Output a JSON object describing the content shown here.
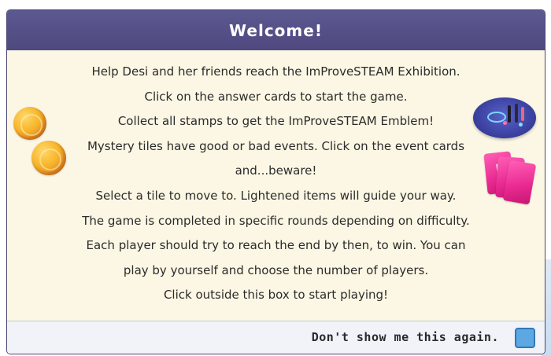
{
  "dialog": {
    "title": "Welcome!",
    "lines": [
      "Help Desi and her friends reach the ImProveSTEAM Exhibition.",
      "Click on the answer cards to start the game.",
      "Collect all stamps to get the ImProveSTEAM Emblem!",
      "Mystery tiles have good or bad events. Click on the event cards",
      "and...beware!",
      "Select a tile to move to. Lightened items will guide your way.",
      "The game is completed in specific rounds depending on difficulty.",
      "Each player should try to reach the end by then, to win. You can",
      "play by yourself and choose the number of players.",
      "Click outside this box to start playing!"
    ],
    "footer": {
      "dont_show_label": "Don't show me this again."
    },
    "card_symbol": "!"
  },
  "icons": {
    "coins": "coin-icon",
    "event_cards": "event-cards-icon",
    "exhibition": "exhibition-icon"
  },
  "colors": {
    "header": "#524e86",
    "body": "#fbf7e4",
    "footer": "#f1f3f9",
    "checkbox": "#5da8e2",
    "event_card": "#e8288f",
    "coin": "#f7b52a"
  }
}
